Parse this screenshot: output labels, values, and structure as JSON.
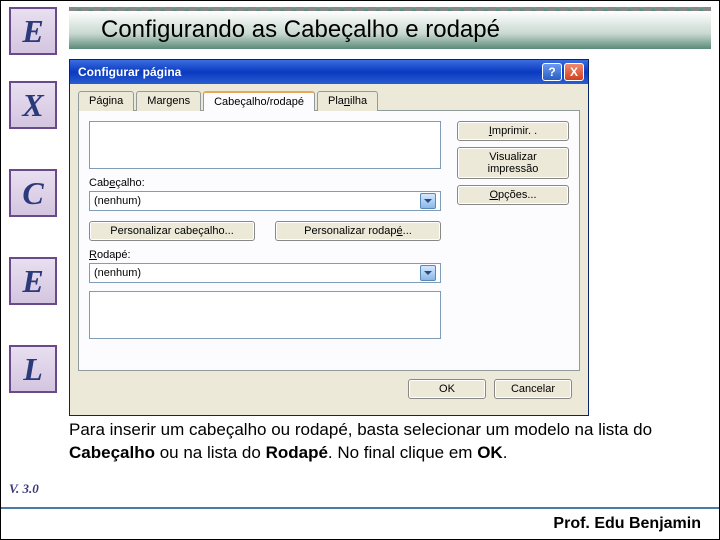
{
  "side_letters": [
    "E",
    "X",
    "C",
    "E",
    "L"
  ],
  "title": "Configurando as Cabeçalho e rodapé",
  "dialog": {
    "title": "Configurar página",
    "tabs": [
      "Página",
      "Margens",
      "Cabeçalho/rodapé",
      "Planilha"
    ],
    "active_tab": 2,
    "right_buttons": {
      "print": "Imprimir. .",
      "preview": "Visualizar impressão",
      "options": "Opções..."
    },
    "header": {
      "label": "Cabeçalho:",
      "value": "(nenhum)"
    },
    "footer_field": {
      "label": "Rodapé:",
      "value": "(nenhum)"
    },
    "customize_header": "Personalizar cabeçalho...",
    "customize_footer": "Personalizar rodapé...",
    "ok": "OK",
    "cancel": "Cancelar"
  },
  "caption": {
    "part1": "Para inserir um cabeçalho ou rodapé, basta selecionar um modelo na lista do ",
    "bold1": "Cabeçalho",
    "part2": " ou na lista do ",
    "bold2": "Rodapé",
    "part3": ". No final clique em ",
    "bold3": "OK",
    "part4": "."
  },
  "version": "V. 3.0",
  "footer": "Prof. Edu Benjamin"
}
